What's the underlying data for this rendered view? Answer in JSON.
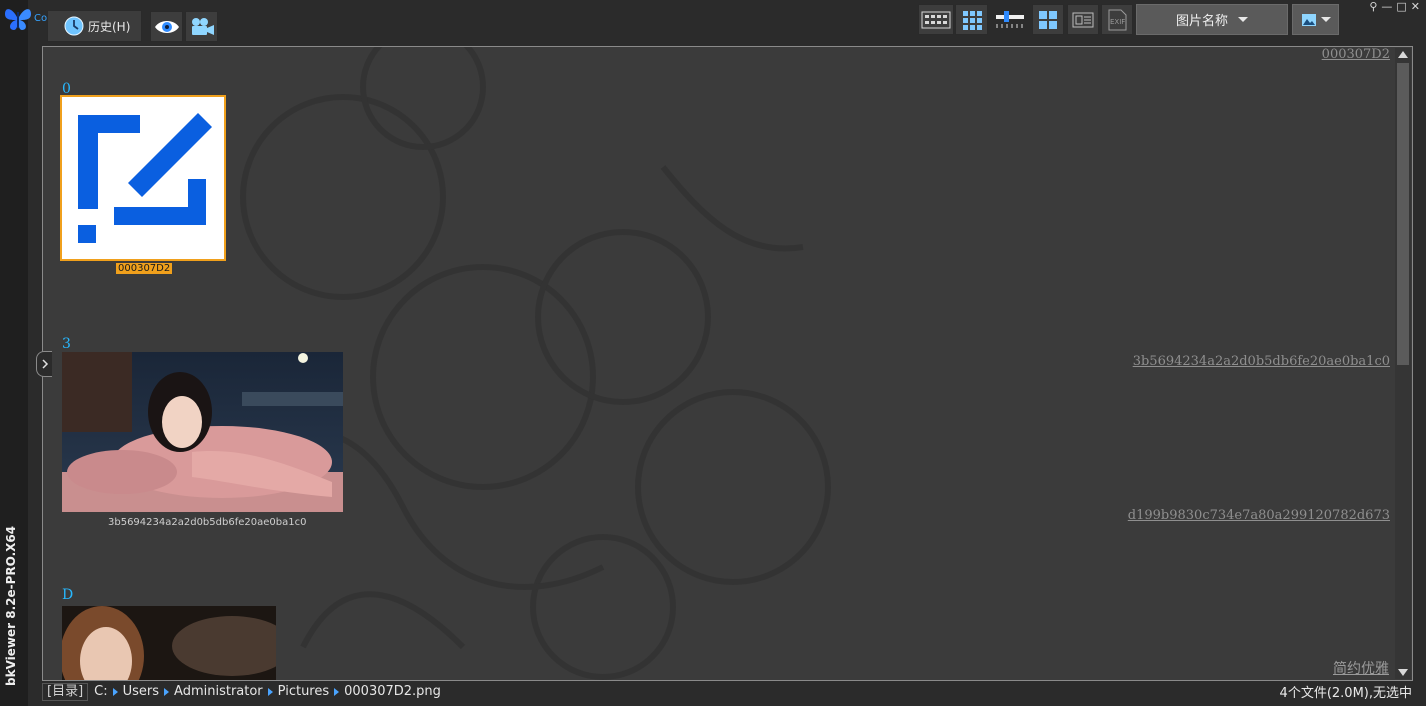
{
  "app": {
    "logo_text": "Co",
    "vertical_title": "bkViewer 8.2e-PRO.X64"
  },
  "toolbar": {
    "history_label": "历史(H)",
    "sort_label": "图片名称",
    "exif_label": "EXIF",
    "window_controls": [
      "⚲",
      "—",
      "□",
      "✕"
    ]
  },
  "gallery": {
    "groups": [
      {
        "letter": "0",
        "caption": "000307D2",
        "right_label": "000307D2"
      },
      {
        "letter": "3",
        "caption": "3b5694234a2a2d0b5db6fe20ae0ba1c0",
        "right_label": "3b5694234a2a2d0b5db6fe20ae0ba1c0"
      },
      {
        "letter": "D",
        "caption": "",
        "right_label": "d199b9830c734e7a80a299120782d673"
      }
    ],
    "footer_hint": "简约优雅"
  },
  "status": {
    "dir_label": "[目录]",
    "path": [
      "C:",
      "Users",
      "Administrator",
      "Pictures",
      "000307D2.png"
    ],
    "count": "4个文件(2.0M),无选中"
  },
  "colors": {
    "accent": "#27b8ff",
    "selection": "#f0a01c",
    "icon_blue": "#0a5fe0"
  }
}
